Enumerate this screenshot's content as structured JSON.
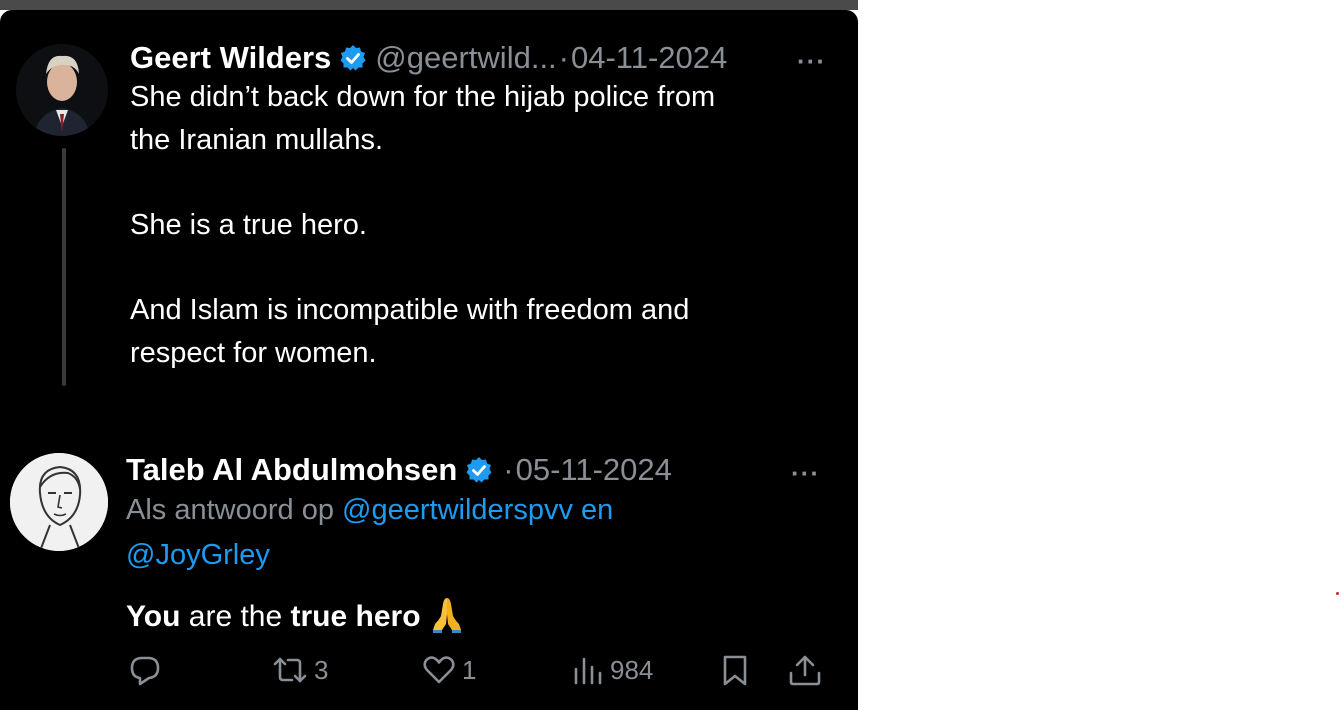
{
  "tweet": {
    "author_name": "Geert Wilders",
    "handle": "@geertwild...",
    "separator": "·",
    "date": "04-11-2024",
    "more_label": "···",
    "lines": [
      "She didn’t back down for the hijab police from",
      "the Iranian mullahs.",
      "She is a true hero.",
      "And Islam is incompatible with freedom and",
      "respect for women."
    ]
  },
  "reply": {
    "author_name": "Taleb Al Abdulmohsen",
    "separator": "·",
    "date": "05-11-2024",
    "more_label": "···",
    "reply_prefix": "Als antwoord op",
    "mention_1": "@geertwilderspvv en",
    "mention_2": "@JoyGrley",
    "text_part_1": "You",
    "text_part_2": " are the ",
    "text_part_3": "true hero",
    "emoji_icon": "folded-hands-icon",
    "actions": {
      "reply_icon": "reply-icon",
      "repost_icon": "repost-icon",
      "repost_count": "3",
      "like_icon": "heart-icon",
      "like_count": "1",
      "views_icon": "views-icon",
      "view_count": "984",
      "bookmark_icon": "bookmark-icon",
      "share_icon": "share-icon"
    }
  },
  "colors": {
    "background": "#000000",
    "text": "#ffffff",
    "muted": "#8a8f96",
    "link": "#1d9bf0",
    "verified": "#1d9bf0"
  }
}
